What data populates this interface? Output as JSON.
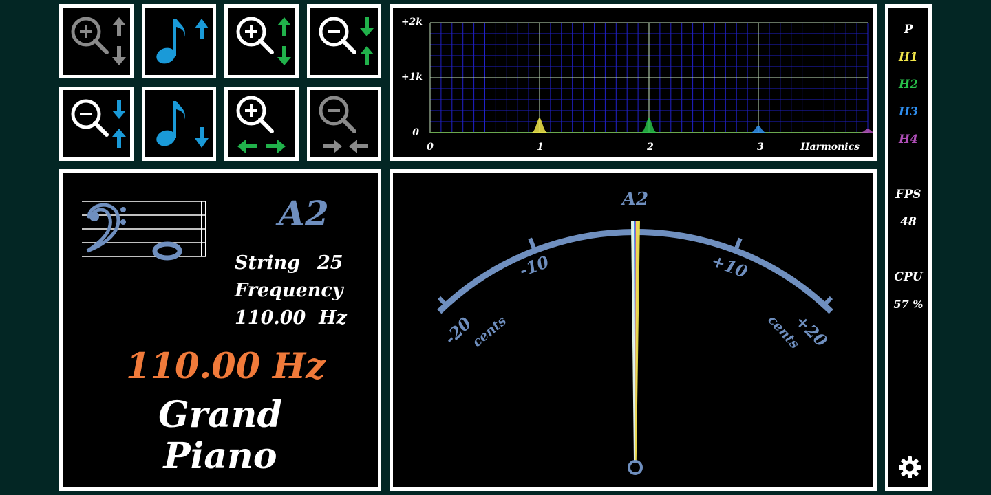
{
  "colors": {
    "accent_blue": "#1a9ad8",
    "accent_green": "#21b24b",
    "disabled_gray": "#8a8a8a",
    "meter_blue": "#6f8fbf",
    "frequency_orange": "#f07a3a",
    "h1": "#f2e74a",
    "h2": "#28c04a",
    "h3": "#2f8ff0",
    "h4": "#b04fb8"
  },
  "toolbar": {
    "buttons": [
      {
        "icon": "zoom-in-vertical-icon",
        "enabled": false
      },
      {
        "icon": "note-up-icon",
        "enabled": true
      },
      {
        "icon": "zoom-in-vertical-icon",
        "enabled": true
      },
      {
        "icon": "zoom-out-vertical-icon",
        "enabled": true
      },
      {
        "icon": "zoom-out-vertical-icon",
        "enabled": true
      },
      {
        "icon": "note-down-icon",
        "enabled": true
      },
      {
        "icon": "zoom-in-horizontal-icon",
        "enabled": true
      },
      {
        "icon": "zoom-out-horizontal-icon",
        "enabled": false
      }
    ]
  },
  "spectrum": {
    "y_ticks": [
      "+2k",
      "+1k",
      "0"
    ],
    "x_ticks": [
      "0",
      "1",
      "2",
      "3"
    ],
    "x_label": "Harmonics"
  },
  "chart_data": {
    "type": "area",
    "xlabel": "Harmonics",
    "ylabel": "",
    "xlim": [
      0,
      4
    ],
    "ylim": [
      0,
      2000
    ],
    "x_ticks": [
      0,
      1,
      2,
      3
    ],
    "y_tick_labels": [
      "0",
      "+1k",
      "+2k"
    ],
    "grid": true,
    "peaks": [
      {
        "harmonic": 1,
        "value": 270,
        "color": "#f2e74a"
      },
      {
        "harmonic": 2,
        "value": 270,
        "color": "#28c04a"
      },
      {
        "harmonic": 3,
        "value": 130,
        "color": "#2f8ff0"
      },
      {
        "harmonic": 4,
        "value": 70,
        "color": "#b04fb8"
      }
    ]
  },
  "note_panel": {
    "note": "A2",
    "string_label": "String",
    "string_number": "25",
    "frequency_label": "Frequency",
    "frequency_value": "110.00  Hz",
    "measured_frequency": "110.00 Hz",
    "instrument_line1": "Grand",
    "instrument_line2": "Piano"
  },
  "meter": {
    "note": "A2",
    "minus20": "-20",
    "minus10": "-10",
    "plus10": "+10",
    "plus20": "+20",
    "cents_left": "cents",
    "cents_right": "cents",
    "deviation_cents": 0
  },
  "sidebar": {
    "p_label": "P",
    "h1": "H1",
    "h2": "H2",
    "h3": "H3",
    "h4": "H4",
    "fps_label": "FPS",
    "fps_value": "48",
    "cpu_label": "CPU",
    "cpu_value": "57 %",
    "settings_icon": "gear-icon"
  }
}
